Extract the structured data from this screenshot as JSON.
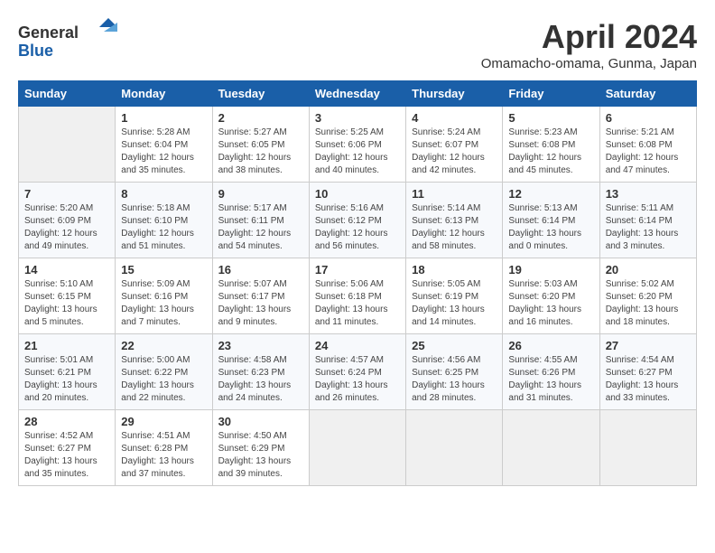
{
  "header": {
    "logo_line1": "General",
    "logo_line2": "Blue",
    "month_title": "April 2024",
    "location": "Omamacho-omama, Gunma, Japan"
  },
  "weekdays": [
    "Sunday",
    "Monday",
    "Tuesday",
    "Wednesday",
    "Thursday",
    "Friday",
    "Saturday"
  ],
  "weeks": [
    [
      {
        "day": "",
        "empty": true
      },
      {
        "day": "1",
        "sunrise": "Sunrise: 5:28 AM",
        "sunset": "Sunset: 6:04 PM",
        "daylight": "Daylight: 12 hours and 35 minutes."
      },
      {
        "day": "2",
        "sunrise": "Sunrise: 5:27 AM",
        "sunset": "Sunset: 6:05 PM",
        "daylight": "Daylight: 12 hours and 38 minutes."
      },
      {
        "day": "3",
        "sunrise": "Sunrise: 5:25 AM",
        "sunset": "Sunset: 6:06 PM",
        "daylight": "Daylight: 12 hours and 40 minutes."
      },
      {
        "day": "4",
        "sunrise": "Sunrise: 5:24 AM",
        "sunset": "Sunset: 6:07 PM",
        "daylight": "Daylight: 12 hours and 42 minutes."
      },
      {
        "day": "5",
        "sunrise": "Sunrise: 5:23 AM",
        "sunset": "Sunset: 6:08 PM",
        "daylight": "Daylight: 12 hours and 45 minutes."
      },
      {
        "day": "6",
        "sunrise": "Sunrise: 5:21 AM",
        "sunset": "Sunset: 6:08 PM",
        "daylight": "Daylight: 12 hours and 47 minutes."
      }
    ],
    [
      {
        "day": "7",
        "sunrise": "Sunrise: 5:20 AM",
        "sunset": "Sunset: 6:09 PM",
        "daylight": "Daylight: 12 hours and 49 minutes."
      },
      {
        "day": "8",
        "sunrise": "Sunrise: 5:18 AM",
        "sunset": "Sunset: 6:10 PM",
        "daylight": "Daylight: 12 hours and 51 minutes."
      },
      {
        "day": "9",
        "sunrise": "Sunrise: 5:17 AM",
        "sunset": "Sunset: 6:11 PM",
        "daylight": "Daylight: 12 hours and 54 minutes."
      },
      {
        "day": "10",
        "sunrise": "Sunrise: 5:16 AM",
        "sunset": "Sunset: 6:12 PM",
        "daylight": "Daylight: 12 hours and 56 minutes."
      },
      {
        "day": "11",
        "sunrise": "Sunrise: 5:14 AM",
        "sunset": "Sunset: 6:13 PM",
        "daylight": "Daylight: 12 hours and 58 minutes."
      },
      {
        "day": "12",
        "sunrise": "Sunrise: 5:13 AM",
        "sunset": "Sunset: 6:14 PM",
        "daylight": "Daylight: 13 hours and 0 minutes."
      },
      {
        "day": "13",
        "sunrise": "Sunrise: 5:11 AM",
        "sunset": "Sunset: 6:14 PM",
        "daylight": "Daylight: 13 hours and 3 minutes."
      }
    ],
    [
      {
        "day": "14",
        "sunrise": "Sunrise: 5:10 AM",
        "sunset": "Sunset: 6:15 PM",
        "daylight": "Daylight: 13 hours and 5 minutes."
      },
      {
        "day": "15",
        "sunrise": "Sunrise: 5:09 AM",
        "sunset": "Sunset: 6:16 PM",
        "daylight": "Daylight: 13 hours and 7 minutes."
      },
      {
        "day": "16",
        "sunrise": "Sunrise: 5:07 AM",
        "sunset": "Sunset: 6:17 PM",
        "daylight": "Daylight: 13 hours and 9 minutes."
      },
      {
        "day": "17",
        "sunrise": "Sunrise: 5:06 AM",
        "sunset": "Sunset: 6:18 PM",
        "daylight": "Daylight: 13 hours and 11 minutes."
      },
      {
        "day": "18",
        "sunrise": "Sunrise: 5:05 AM",
        "sunset": "Sunset: 6:19 PM",
        "daylight": "Daylight: 13 hours and 14 minutes."
      },
      {
        "day": "19",
        "sunrise": "Sunrise: 5:03 AM",
        "sunset": "Sunset: 6:20 PM",
        "daylight": "Daylight: 13 hours and 16 minutes."
      },
      {
        "day": "20",
        "sunrise": "Sunrise: 5:02 AM",
        "sunset": "Sunset: 6:20 PM",
        "daylight": "Daylight: 13 hours and 18 minutes."
      }
    ],
    [
      {
        "day": "21",
        "sunrise": "Sunrise: 5:01 AM",
        "sunset": "Sunset: 6:21 PM",
        "daylight": "Daylight: 13 hours and 20 minutes."
      },
      {
        "day": "22",
        "sunrise": "Sunrise: 5:00 AM",
        "sunset": "Sunset: 6:22 PM",
        "daylight": "Daylight: 13 hours and 22 minutes."
      },
      {
        "day": "23",
        "sunrise": "Sunrise: 4:58 AM",
        "sunset": "Sunset: 6:23 PM",
        "daylight": "Daylight: 13 hours and 24 minutes."
      },
      {
        "day": "24",
        "sunrise": "Sunrise: 4:57 AM",
        "sunset": "Sunset: 6:24 PM",
        "daylight": "Daylight: 13 hours and 26 minutes."
      },
      {
        "day": "25",
        "sunrise": "Sunrise: 4:56 AM",
        "sunset": "Sunset: 6:25 PM",
        "daylight": "Daylight: 13 hours and 28 minutes."
      },
      {
        "day": "26",
        "sunrise": "Sunrise: 4:55 AM",
        "sunset": "Sunset: 6:26 PM",
        "daylight": "Daylight: 13 hours and 31 minutes."
      },
      {
        "day": "27",
        "sunrise": "Sunrise: 4:54 AM",
        "sunset": "Sunset: 6:27 PM",
        "daylight": "Daylight: 13 hours and 33 minutes."
      }
    ],
    [
      {
        "day": "28",
        "sunrise": "Sunrise: 4:52 AM",
        "sunset": "Sunset: 6:27 PM",
        "daylight": "Daylight: 13 hours and 35 minutes."
      },
      {
        "day": "29",
        "sunrise": "Sunrise: 4:51 AM",
        "sunset": "Sunset: 6:28 PM",
        "daylight": "Daylight: 13 hours and 37 minutes."
      },
      {
        "day": "30",
        "sunrise": "Sunrise: 4:50 AM",
        "sunset": "Sunset: 6:29 PM",
        "daylight": "Daylight: 13 hours and 39 minutes."
      },
      {
        "day": "",
        "empty": true
      },
      {
        "day": "",
        "empty": true
      },
      {
        "day": "",
        "empty": true
      },
      {
        "day": "",
        "empty": true
      }
    ]
  ]
}
